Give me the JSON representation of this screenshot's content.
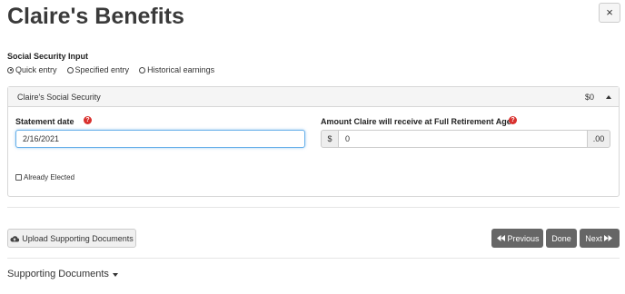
{
  "page": {
    "title": "Claire's Benefits",
    "close_label": "×"
  },
  "social_security_input": {
    "label": "Social Security Input",
    "options": [
      {
        "label": "Quick entry",
        "selected": true
      },
      {
        "label": "Specified entry",
        "selected": false
      },
      {
        "label": "Historical earnings",
        "selected": false
      }
    ]
  },
  "panel": {
    "title": "Claire's Social Security",
    "amount": "$0",
    "statement_date": {
      "label": "Statement date",
      "value": "2/16/2021"
    },
    "fra_amount": {
      "label": "Amount Claire will receive at Full Retirement Age",
      "prefix": "$",
      "value": "0",
      "suffix": ".00"
    },
    "already_elected": {
      "label": "Already Elected",
      "checked": false
    }
  },
  "actions": {
    "upload_label": "Upload Supporting Documents",
    "previous_label": "Previous",
    "done_label": "Done",
    "next_label": "Next"
  },
  "supporting_documents": {
    "label": "Supporting Documents"
  },
  "icons": {
    "help": "question-circle",
    "upload": "cloud-upload",
    "previous": "backward",
    "next": "forward"
  },
  "colors": {
    "help_red": "#d9312e",
    "dark_button": "#666666",
    "focus_blue": "#66afe9"
  }
}
